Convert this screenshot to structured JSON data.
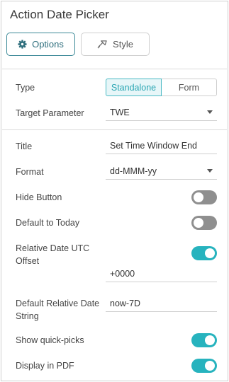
{
  "panel": {
    "title": "Action Date Picker",
    "buttons": {
      "options": "Options",
      "style": "Style"
    },
    "type": {
      "label": "Type",
      "options": [
        "Standalone",
        "Form"
      ],
      "selected": "Standalone"
    },
    "target_parameter": {
      "label": "Target Parameter",
      "value": "TWE"
    },
    "title_field": {
      "label": "Title",
      "value": "Set Time Window End"
    },
    "format": {
      "label": "Format",
      "value": "dd-MMM-yy"
    },
    "hide_button": {
      "label": "Hide Button",
      "on": false
    },
    "default_to_today": {
      "label": "Default to Today",
      "on": false
    },
    "relative_utc_offset": {
      "label_line1": "Relative Date UTC",
      "label_line2": "Offset",
      "on": true,
      "value": "+0000"
    },
    "default_relative": {
      "label_line1": "Default Relative Date",
      "label_line2": "String",
      "value": "now-7D"
    },
    "show_quick_picks": {
      "label": "Show quick-picks",
      "on": true
    },
    "display_in_pdf": {
      "label": "Display in PDF",
      "on": true
    }
  },
  "colors": {
    "accent": "#27b3be",
    "toggle_off": "#8f8f8f",
    "options_border": "#3d8a98"
  },
  "icons": {
    "options": "gear-icon",
    "style": "paint-brush-icon",
    "dropdown": "chevron-down-icon"
  }
}
